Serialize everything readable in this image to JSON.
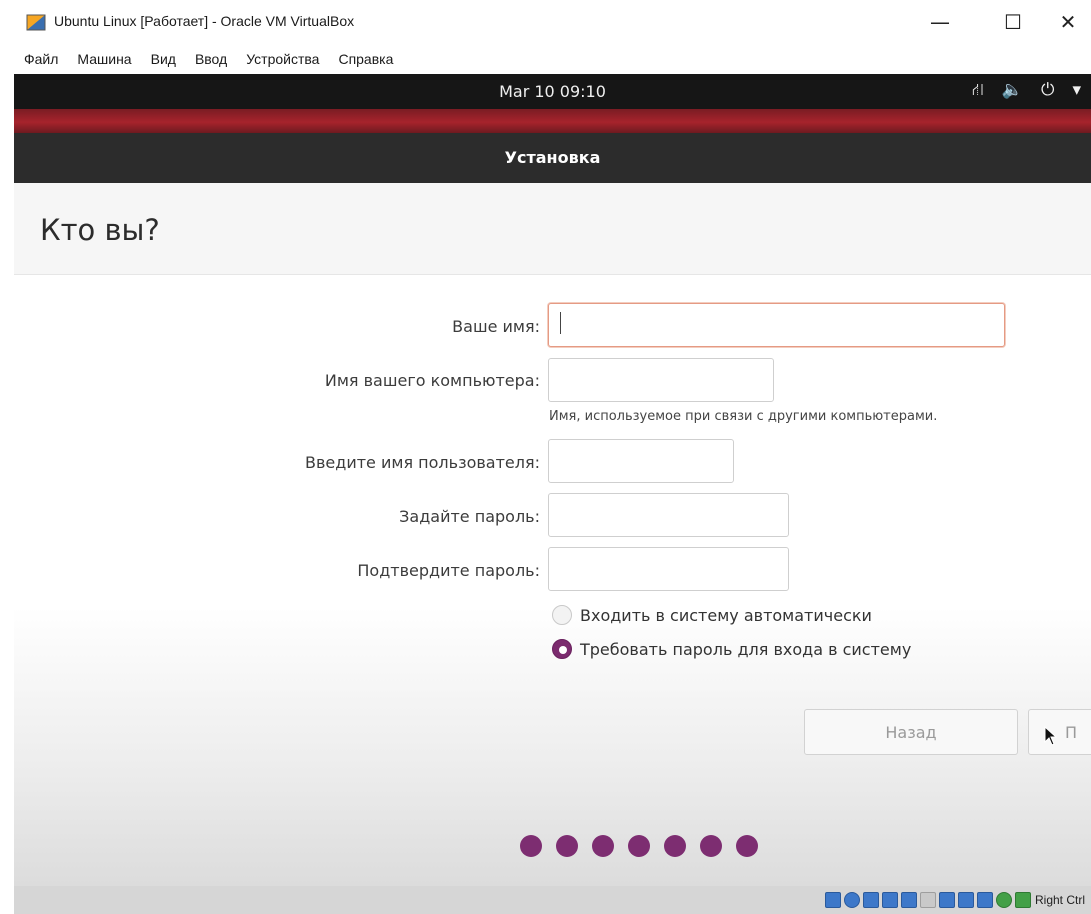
{
  "host_window": {
    "title": "Ubuntu Linux [Работает] - Oracle VM VirtualBox",
    "minimize_glyph": "—",
    "maximize_glyph": "☐",
    "close_glyph": "✕"
  },
  "host_menu": [
    "Файл",
    "Машина",
    "Вид",
    "Ввод",
    "Устройства",
    "Справка"
  ],
  "panel": {
    "clock": "Mar 10  09:10",
    "icons": [
      "network-icon",
      "volume-icon",
      "power-icon",
      "chevron-down-icon"
    ],
    "network_glyph": "⛙",
    "volume_glyph": "🔈",
    "power_glyph": "⏻",
    "menu_glyph": "▾"
  },
  "installer": {
    "header_title": "Установка",
    "page_title": "Кто вы?",
    "fields": {
      "your_name": {
        "label": "Ваше имя:",
        "value": ""
      },
      "computer_name": {
        "label": "Имя вашего компьютера:",
        "value": "",
        "hint": "Имя, используемое при связи с другими компьютерами."
      },
      "username": {
        "label": "Введите имя пользователя:",
        "value": ""
      },
      "password": {
        "label": "Задайте пароль:",
        "value": ""
      },
      "confirm_password": {
        "label": "Подтвердите пароль:",
        "value": ""
      }
    },
    "login_options": [
      {
        "label": "Входить в систему автоматически",
        "selected": false
      },
      {
        "label": "Требовать пароль для входа в систему",
        "selected": true
      }
    ],
    "buttons": {
      "back": "Назад",
      "next": "П"
    },
    "progress_dots": 7,
    "accent_color": "#7d2d71"
  },
  "vb_status": {
    "host_key": "Right Ctrl"
  }
}
